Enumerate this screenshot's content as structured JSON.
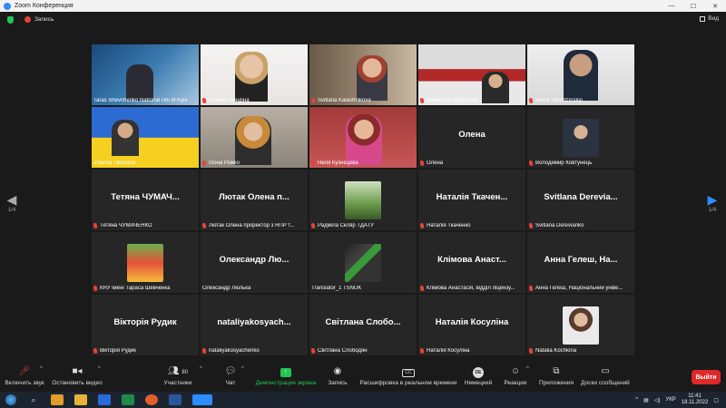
{
  "window": {
    "title": "Zoom Конференция"
  },
  "top": {
    "record_label": "Запись",
    "view_label": "Вид"
  },
  "pager": {
    "left": "1/4",
    "right": "1/4"
  },
  "tiles": [
    {
      "name": "Taras Shevchenko National Uni of Kyiv",
      "big": ""
    },
    {
      "name": "Євгенія Линдіна",
      "big": ""
    },
    {
      "name": "Svitlana Kalashnikova",
      "big": ""
    },
    {
      "name": "Вячеслав ЦИХАТИЙ",
      "big": ""
    },
    {
      "name": "Serhii Yahodzinskyi",
      "big": ""
    },
    {
      "name": "Zhanna Talanova",
      "big": ""
    },
    {
      "name": "Ілона Рожко",
      "big": ""
    },
    {
      "name": "Неля Кузнєцова",
      "big": ""
    },
    {
      "name": "Олена",
      "big": "Олена"
    },
    {
      "name": "Володимир Ковтунець",
      "big": ""
    },
    {
      "name": "Тетяна ЧУМАЧЕНКО",
      "big": "Тетяна ЧУМАЧ..."
    },
    {
      "name": "Лютак Олена проректор з НПР т...",
      "big": "Лютак Олена п..."
    },
    {
      "name": "Радміла Скляр ТДАТУ",
      "big": ""
    },
    {
      "name": "Наталія Ткаченко",
      "big": "Наталія Ткачен..."
    },
    {
      "name": "Svitlana Derevianko",
      "big": "Svitlana Derevia..."
    },
    {
      "name": "КНУ імені Тараса Шевченка",
      "big": ""
    },
    {
      "name": "Олександр Люлька",
      "big": "Олександр Лю..."
    },
    {
      "name": "Translator_1 TSNUK",
      "big": ""
    },
    {
      "name": "Клімова Анастасія, відділ ліцензу...",
      "big": "Клімова Анаст..."
    },
    {
      "name": "Анна Гелеш, Національний уніве...",
      "big": "Анна Гелеш, На..."
    },
    {
      "name": "Вікторія Рудик",
      "big": "Вікторія Рудик"
    },
    {
      "name": "nataliyakosyachenko",
      "big": "nataliyakosyach..."
    },
    {
      "name": "Світлана Слободян",
      "big": "Світлана Слобо..."
    },
    {
      "name": "Наталія Косуліна",
      "big": "Наталія Косуліна"
    },
    {
      "name": "Natalia Kochkina",
      "big": ""
    }
  ],
  "toolbar": {
    "unmute": "Включить звук",
    "stop_video": "Остановить видео",
    "participants": "Участники",
    "participants_count": "80",
    "chat": "Чат",
    "share": "Демонстрация экрана",
    "record": "Запись",
    "captions": "Расшифровка в реальном времени",
    "interpret": "Немецкий",
    "interpret_badge": "DE",
    "reactions": "Реакции",
    "apps": "Приложения",
    "whiteboard": "Доски сообщений",
    "leave": "Выйти",
    "captions_badge": "CC"
  },
  "taskbar": {
    "lang": "УКР",
    "time": "11:41",
    "date": "18.11.2022"
  },
  "colors": {
    "share_green": "#23c552",
    "leave_red": "#e02828",
    "speaker_border": "#f0c000",
    "accent_blue": "#2d8cff"
  }
}
